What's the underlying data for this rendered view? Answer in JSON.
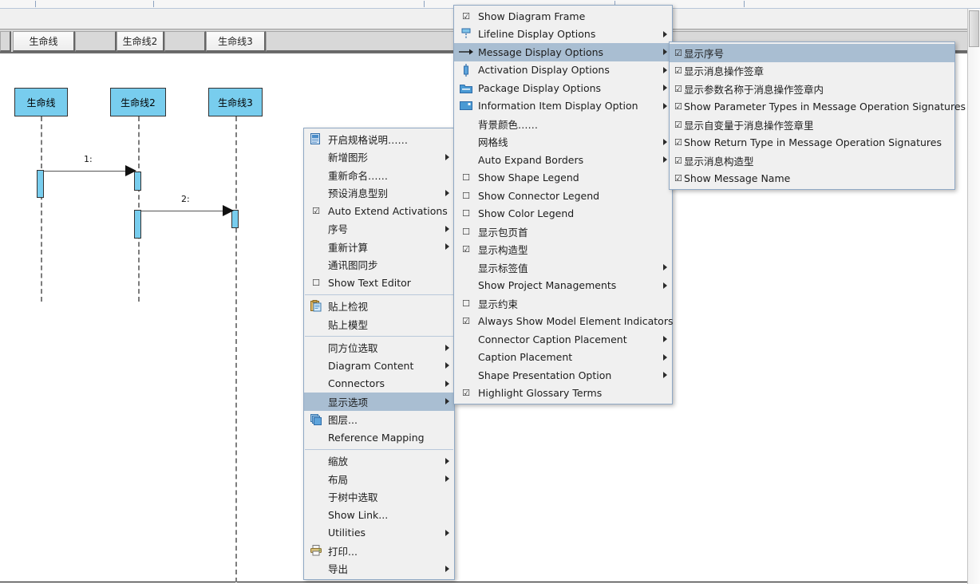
{
  "diagram": {
    "column_headers": [
      "生命线",
      "生命线2",
      "生命线3"
    ],
    "lifelines": [
      {
        "name": "生命线"
      },
      {
        "name": "生命线2"
      },
      {
        "name": "生命线3"
      }
    ],
    "messages": [
      {
        "label": "1:",
        "from": "生命线",
        "to": "生命线2"
      },
      {
        "label": "2:",
        "from": "生命线2",
        "to": "生命线3"
      }
    ],
    "colors": {
      "lifeline_fill": "#78cdee",
      "lifeline_border": "#333333",
      "message_line": "#555555",
      "canvas_bg": "#ffffff"
    }
  },
  "context_menu": {
    "items": [
      {
        "label": "开启规格说明……",
        "icon": "specification-icon",
        "check": "",
        "submenu": false
      },
      {
        "label": "新增图形",
        "icon": "",
        "check": "",
        "submenu": true
      },
      {
        "label": "重新命名……",
        "icon": "",
        "check": "",
        "submenu": false
      },
      {
        "label": "预设消息型别",
        "icon": "",
        "check": "",
        "submenu": true
      },
      {
        "label": "Auto Extend Activations",
        "icon": "",
        "check": "☑",
        "submenu": false
      },
      {
        "label": "序号",
        "icon": "",
        "check": "",
        "submenu": true
      },
      {
        "label": "重新计算",
        "icon": "",
        "check": "",
        "submenu": true
      },
      {
        "label": "通讯图同步",
        "icon": "",
        "check": "",
        "submenu": false
      },
      {
        "label": "Show Text Editor",
        "icon": "",
        "check": "☐",
        "submenu": false
      },
      {
        "separator": true
      },
      {
        "label": "贴上检视",
        "icon": "clipboard-icon",
        "check": "",
        "submenu": false
      },
      {
        "label": "贴上模型",
        "icon": "",
        "check": "",
        "submenu": false
      },
      {
        "separator": true
      },
      {
        "label": "同方位选取",
        "icon": "",
        "check": "",
        "submenu": true
      },
      {
        "label": "Diagram Content",
        "icon": "",
        "check": "",
        "submenu": true
      },
      {
        "label": "Connectors",
        "icon": "",
        "check": "",
        "submenu": true
      },
      {
        "label": "显示选项",
        "icon": "",
        "check": "",
        "submenu": true,
        "highlighted": true
      },
      {
        "label": "图层...",
        "icon": "layers-icon",
        "check": "",
        "submenu": false
      },
      {
        "label": "Reference Mapping",
        "icon": "",
        "check": "",
        "submenu": false
      },
      {
        "separator": true
      },
      {
        "label": "缩放",
        "icon": "",
        "check": "",
        "submenu": true
      },
      {
        "label": "布局",
        "icon": "",
        "check": "",
        "submenu": true
      },
      {
        "label": "于树中选取",
        "icon": "",
        "check": "",
        "submenu": false
      },
      {
        "label": "Show Link...",
        "icon": "",
        "check": "",
        "submenu": false
      },
      {
        "label": "Utilities",
        "icon": "",
        "check": "",
        "submenu": true
      },
      {
        "label": "打印...",
        "icon": "printer-icon",
        "check": "",
        "submenu": false
      },
      {
        "label": "导出",
        "icon": "",
        "check": "",
        "submenu": true
      }
    ]
  },
  "display_options_menu": {
    "items": [
      {
        "label": "Show Diagram Frame",
        "icon": "",
        "check": "☑",
        "submenu": false
      },
      {
        "label": "Lifeline Display Options",
        "icon": "lifeline-icon",
        "check": "",
        "submenu": true
      },
      {
        "label": "Message Display Options",
        "icon": "message-arrow-icon",
        "check": "",
        "submenu": true,
        "highlighted": true
      },
      {
        "label": "Activation Display Options",
        "icon": "activation-icon",
        "check": "",
        "submenu": true
      },
      {
        "label": "Package Display Options",
        "icon": "package-folder-icon",
        "check": "",
        "submenu": true
      },
      {
        "label": "Information Item Display Option",
        "icon": "information-item-icon",
        "check": "",
        "submenu": true
      },
      {
        "label": "背景颜色……",
        "icon": "",
        "check": "",
        "submenu": false
      },
      {
        "label": "网格线",
        "icon": "",
        "check": "",
        "submenu": true
      },
      {
        "label": "Auto Expand Borders",
        "icon": "",
        "check": "",
        "submenu": true
      },
      {
        "label": "Show Shape Legend",
        "icon": "",
        "check": "☐",
        "submenu": false
      },
      {
        "label": "Show Connector Legend",
        "icon": "",
        "check": "☐",
        "submenu": false
      },
      {
        "label": "Show Color Legend",
        "icon": "",
        "check": "☐",
        "submenu": false
      },
      {
        "label": "显示包页首",
        "icon": "",
        "check": "☐",
        "submenu": false
      },
      {
        "label": "显示构造型",
        "icon": "",
        "check": "☑",
        "submenu": false
      },
      {
        "label": "显示标签值",
        "icon": "",
        "check": "",
        "submenu": true
      },
      {
        "label": "Show Project Managements",
        "icon": "",
        "check": "",
        "submenu": true
      },
      {
        "label": "显示约束",
        "icon": "",
        "check": "☐",
        "submenu": false
      },
      {
        "label": "Always Show Model Element Indicators",
        "icon": "",
        "check": "☑",
        "submenu": false
      },
      {
        "label": "Connector Caption Placement",
        "icon": "",
        "check": "",
        "submenu": true
      },
      {
        "label": "Caption Placement",
        "icon": "",
        "check": "",
        "submenu": true
      },
      {
        "label": "Shape Presentation Option",
        "icon": "",
        "check": "",
        "submenu": true
      },
      {
        "label": "Highlight Glossary Terms",
        "icon": "",
        "check": "☑",
        "submenu": false
      }
    ]
  },
  "message_display_menu": {
    "items": [
      {
        "label": "显示序号",
        "check": "☑",
        "highlighted": true
      },
      {
        "label": "显示消息操作签章",
        "check": "☑"
      },
      {
        "label": "显示参数名称于消息操作签章内",
        "check": "☑"
      },
      {
        "label": "Show Parameter Types in Message Operation Signatures",
        "check": "☑"
      },
      {
        "label": "显示自变量于消息操作签章里",
        "check": "☑"
      },
      {
        "label": "Show Return Type in Message Operation Signatures",
        "check": "☑"
      },
      {
        "label": "显示消息构造型",
        "check": "☑"
      },
      {
        "label": "Show Message Name",
        "check": "☑"
      }
    ]
  },
  "colors": {
    "menu_bg": "#f0f0f0",
    "menu_border": "#8fa8c4",
    "highlight": "#a9bed2",
    "lifeline_fill": "#78cdee"
  }
}
